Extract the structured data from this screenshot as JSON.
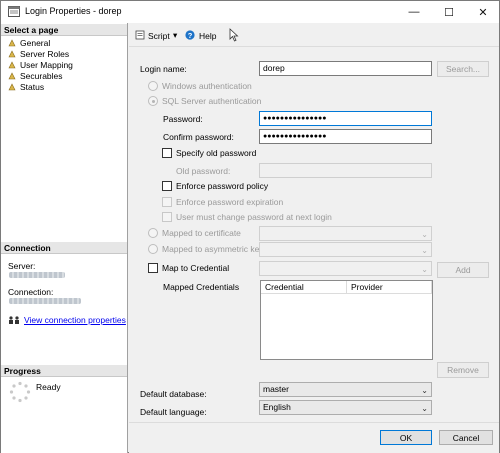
{
  "window": {
    "title": "Login Properties - dorep",
    "controls": {
      "minimize": "—",
      "maximize": "☐",
      "close": "✕"
    }
  },
  "left": {
    "select_page_header": "Select a page",
    "pages": [
      "General",
      "Server Roles",
      "User Mapping",
      "Securables",
      "Status"
    ],
    "connection_header": "Connection",
    "server_label": "Server:",
    "connection_label": "Connection:",
    "view_connection_link": "View connection properties",
    "progress_header": "Progress",
    "progress_status": "Ready"
  },
  "toolbar": {
    "script_label": "Script",
    "script_dropdown": "▾",
    "help_label": "Help"
  },
  "form": {
    "login_name_label": "Login name:",
    "login_name_value": "dorep",
    "search_button": "Search...",
    "windows_auth": "Windows authentication",
    "sql_auth": "SQL Server authentication",
    "password_label": "Password:",
    "password_value": "●●●●●●●●●●●●●●●",
    "confirm_label": "Confirm password:",
    "confirm_value": "●●●●●●●●●●●●●●●",
    "specify_old_password": "Specify old password",
    "old_password_label": "Old password:",
    "enforce_policy": "Enforce password policy",
    "enforce_expiration": "Enforce password expiration",
    "must_change": "User must change password at next login",
    "mapped_cert": "Mapped to certificate",
    "mapped_asym": "Mapped to asymmetric key",
    "map_credential": "Map to Credential",
    "add_button": "Add",
    "mapped_credentials_label": "Mapped Credentials",
    "grid_columns": [
      "Credential",
      "Provider"
    ],
    "remove_button": "Remove",
    "default_db_label": "Default database:",
    "default_db_value": "master",
    "default_lang_label": "Default language:",
    "default_lang_value": "English"
  },
  "footer": {
    "ok_button": "OK",
    "cancel_button": "Cancel"
  },
  "icons": {
    "page": "page-icon",
    "script": "script-icon",
    "help": "help-icon",
    "connection": "connection-properties-icon",
    "progress": "progress-spinner-icon"
  },
  "colors": {
    "accent": "#0078d7",
    "link": "#0000ee"
  }
}
